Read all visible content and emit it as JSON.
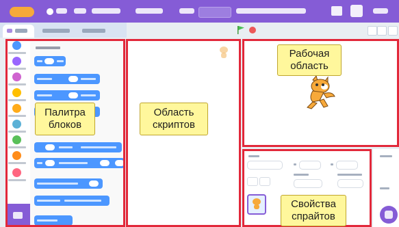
{
  "annotations": {
    "palette": [
      "Палитра",
      "блоков"
    ],
    "scripts": [
      "Область",
      "скриптов"
    ],
    "stage": [
      "Рабочая",
      "область"
    ],
    "sprite_props": [
      "Свойства",
      "спрайтов"
    ]
  },
  "colors": {
    "menu_bar": "#855cd6",
    "highlight_box": "#e2283a",
    "callout_fill": "#fff79c",
    "motion_blocks": "#4c97ff",
    "cat_motion": "#4c97ff",
    "cat_looks": "#9966ff",
    "cat_sound": "#cf63cf",
    "cat_events": "#ffbf00",
    "cat_control": "#ffab19",
    "cat_sensing": "#5cb1d6",
    "cat_operators": "#59c059",
    "cat_variables": "#ff8c1a",
    "cat_myblocks": "#ff6680"
  },
  "icons": {
    "green_flag": "green-flag-icon",
    "stop": "stop-icon",
    "sprite": "cat-sprite-icon",
    "extension": "add-extension-icon"
  }
}
